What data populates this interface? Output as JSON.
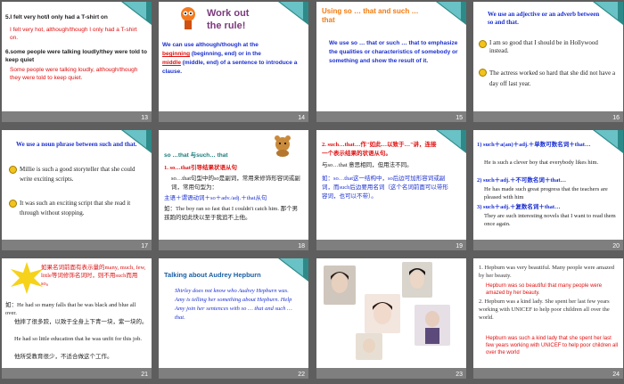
{
  "slides": [
    {
      "num": "13",
      "lines": [
        "5.I felt very hot/I only had a T-shirt on",
        "I felt very hot, although/though I only had a T-shirt on.",
        "6.some people were talking loudly/they were told to keep quiet",
        "Some people were talking loudly, although/though they were told to keep quiet."
      ]
    },
    {
      "num": "14",
      "title": "Work out the rule!",
      "lines": [
        "We can use although/though at the",
        "beginning",
        "(beginning, end) or in the",
        "middle",
        "(middle, end) of a sentence to introduce a clause."
      ]
    },
    {
      "num": "15",
      "title": "Using so … that and such … that",
      "body": "We use so … that or such … that to emphasize the qualities or characteristics of somebody or something and show the result of it."
    },
    {
      "num": "16",
      "lines": [
        "We use an adjective or an adverb between so and that.",
        "I am so good that I should be in Hollywood instead.",
        "The actress worked so hard that she did not have a day off last year."
      ]
    },
    {
      "num": "17",
      "lines": [
        "We use a noun phrase between such and that.",
        "Millie is such a good storyteller that she could write exciting scripts.",
        "It was such an exciting script that she read it through without stopping."
      ]
    },
    {
      "num": "18",
      "title": "so …that 与such… that",
      "lines": [
        "1. so…that引导结果状语从句",
        "so…that句型中的so是副词，常用来修饰形容词或副词，常用句型为：",
        "主语＋谓语动词＋so＋adv./adj.＋that从句",
        "如：The boy ran so fast that I couldn't catch him. 那个男孩跑的如此快以至于我追不上他。"
      ]
    },
    {
      "num": "19",
      "lines": [
        "2. such…that…作\"如此…以致于…\"讲，连接一个表示结果的状语从句。",
        "与so…that 意思相同，但用法不同。",
        "如：so…that这一结构中，so后边可加形容词或副词，而such后边要用名词（这个名词前面可以带形容词，也可以不带）。"
      ]
    },
    {
      "num": "20",
      "lines": [
        "1) such＋a(an)＋adj.＋单数可数名词＋that…",
        "He is such a clever boy that everybody likes him.",
        "2) such＋adj.＋不可数名词＋that…",
        "He has made such great progress that the teachers are pleased with him",
        "3) such＋adj.＋复数名词＋that…",
        "They are such interesting novels that I want to read them once again."
      ]
    },
    {
      "num": "21",
      "lines": [
        "如果名词前面有表示量的many, much, few, little等词修饰名词时，则不用such而用so。",
        "如：He had so many falls that he was black and blue all over.",
        "他摔了很多跤，以致于全身上下青一块，紫一块的。",
        "He had so little education that he was unfit for this job.",
        "他所受教育很少，不适合做这个工作。"
      ]
    },
    {
      "num": "22",
      "title": "Talking about Audrey Hepburn",
      "body": "Shirley does not know who Audrey Hepburn was. Amy is telling her something about Hepburn. Help Amy join her sentences with so … that and such … that."
    },
    {
      "num": "23"
    },
    {
      "num": "24",
      "lines": [
        "1. Hepburn was very beautiful. Many people were amazed by her beauty.",
        "Hepburn was so beautiful that many people were amazed by her beauty.",
        "2. Hepburn was a kind lady. She spent her last few years working with UNICEF to help poor children all over the world.",
        "Hepburn was such a kind lady that she spent her last few years working with UNICEF to help poor children all over the world"
      ]
    }
  ]
}
